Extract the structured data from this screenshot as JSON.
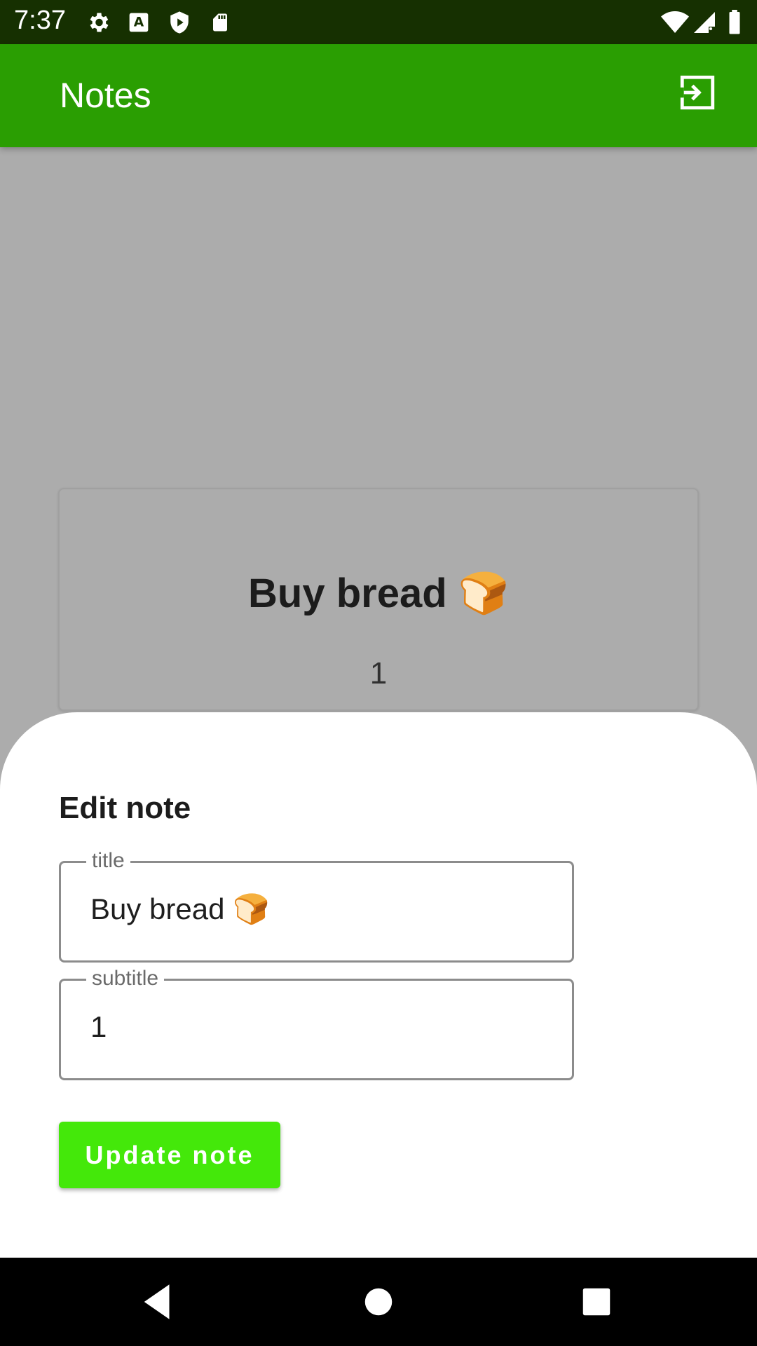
{
  "status_bar": {
    "time": "7:37",
    "icons": [
      "gear-icon",
      "a-keyboard-icon",
      "shield-play-icon",
      "sd-card-icon",
      "wifi-icon",
      "signal-icon",
      "battery-icon"
    ]
  },
  "app_bar": {
    "title": "Notes",
    "logout_icon": "logout-icon",
    "color": "#2a9e02"
  },
  "note": {
    "title": "Buy bread 🍞",
    "subtitle": "1"
  },
  "edit_sheet": {
    "heading": "Edit note",
    "title_field": {
      "label": "title",
      "value": "Buy bread 🍞"
    },
    "subtitle_field": {
      "label": "subtitle",
      "value": "1"
    },
    "button_label": "Update note",
    "button_color": "#44e80a"
  },
  "nav_bar": {
    "icons": [
      "back-icon",
      "home-icon",
      "recents-icon"
    ]
  }
}
